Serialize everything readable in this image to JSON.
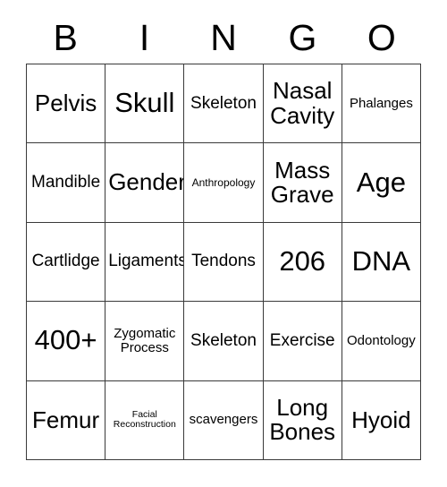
{
  "card": {
    "title": "BINGO",
    "header_letters": [
      "B",
      "I",
      "N",
      "G",
      "O"
    ],
    "columns": 5,
    "rows": 5,
    "border_color": "#3a3a3a",
    "background_color": "#ffffff",
    "text_color": "#000000",
    "cells": [
      {
        "text": "Pelvis",
        "size": "lg"
      },
      {
        "text": "Skull",
        "size": "xl"
      },
      {
        "text": "Skeleton",
        "size": "md"
      },
      {
        "text": "Nasal\nCavity",
        "size": "lg"
      },
      {
        "text": "Phalanges",
        "size": "sm"
      },
      {
        "text": "Mandible",
        "size": "md"
      },
      {
        "text": "Gender",
        "size": "lg"
      },
      {
        "text": "Anthropology",
        "size": "xs"
      },
      {
        "text": "Mass\nGrave",
        "size": "lg"
      },
      {
        "text": "Age",
        "size": "xl"
      },
      {
        "text": "Cartlidge",
        "size": "md"
      },
      {
        "text": "Ligaments",
        "size": "md"
      },
      {
        "text": "Tendons",
        "size": "md"
      },
      {
        "text": "206",
        "size": "xl"
      },
      {
        "text": "DNA",
        "size": "xl"
      },
      {
        "text": "400+",
        "size": "xl"
      },
      {
        "text": "Zygomatic\nProcess",
        "size": "sm"
      },
      {
        "text": "Skeleton",
        "size": "md"
      },
      {
        "text": "Exercise",
        "size": "md"
      },
      {
        "text": "Odontology",
        "size": "sm"
      },
      {
        "text": "Femur",
        "size": "lg"
      },
      {
        "text": "Facial\nReconstruction",
        "size": "xxs"
      },
      {
        "text": "scavengers",
        "size": "sm"
      },
      {
        "text": "Long\nBones",
        "size": "lg"
      },
      {
        "text": "Hyoid",
        "size": "lg"
      }
    ]
  }
}
